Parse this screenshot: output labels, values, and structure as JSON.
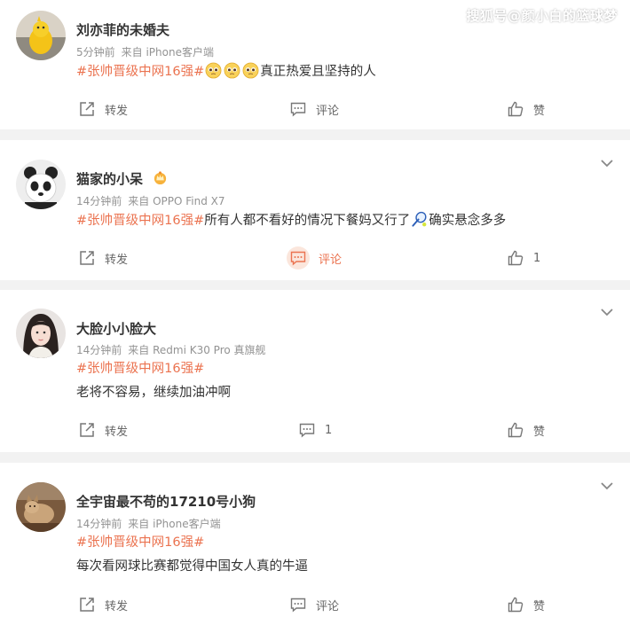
{
  "watermark": "搜狐号@颜小白的篮球梦",
  "actions": {
    "repost": "转发",
    "comment": "评论",
    "like": "赞"
  },
  "posts": [
    {
      "name": "刘亦菲的未婚夫",
      "time": "5分钟前",
      "source": "来自 iPhone客户端",
      "topic": "#张帅晋级中网16强#",
      "text": "真正热爱且坚持的人",
      "emojis": [
        "pleading-face-emoji",
        "pleading-face-emoji",
        "pleading-face-emoji"
      ],
      "comment_count": "",
      "like_count": ""
    },
    {
      "name": "猫家的小呆",
      "badge": "crown-badge-icon",
      "time": "14分钟前",
      "source": "来自 OPPO Find X7",
      "topic": "#张帅晋级中网16强#",
      "text": "所有人都不看好的情况下餐妈又行了",
      "text_after": "确实悬念多多",
      "comment_count": "",
      "like_count": "1"
    },
    {
      "name": "大脸小小脸大",
      "time": "14分钟前",
      "source": "来自 Redmi K30 Pro 真旗舰",
      "topic": "#张帅晋级中网16强#",
      "text": "老将不容易，继续加油冲啊",
      "comment_count": "1",
      "like_count": ""
    },
    {
      "name": "全宇宙最不苟的17210号小狗",
      "time": "14分钟前",
      "source": "来自 iPhone客户端",
      "topic": "#张帅晋级中网16强#",
      "text": "每次看网球比赛都觉得中国女人真的牛逼",
      "comment_count": "",
      "like_count": ""
    }
  ]
}
